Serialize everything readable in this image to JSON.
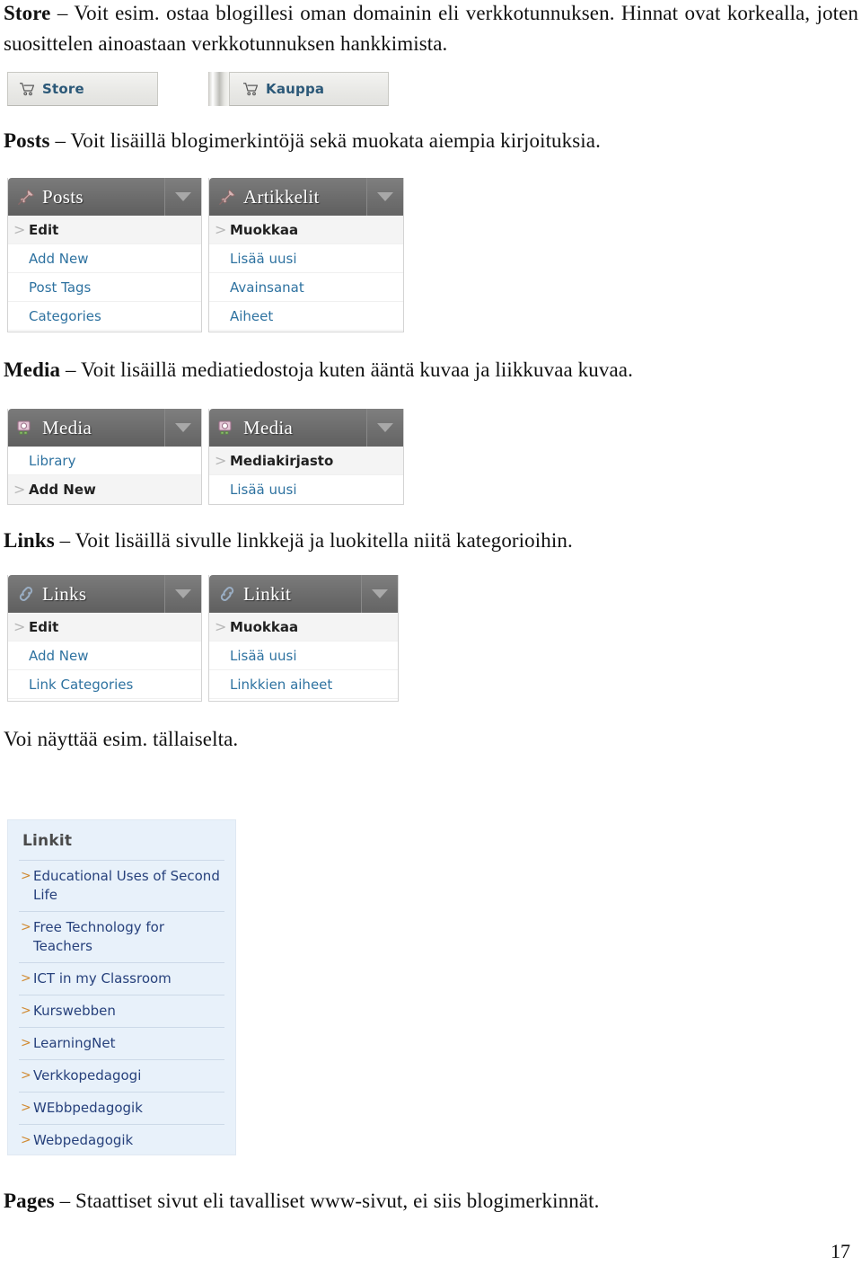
{
  "page": {
    "number": "17"
  },
  "sections": [
    {
      "id": "store",
      "lead": "Store",
      "dash": " – ",
      "text": "Voit esim. ostaa blogillesi oman domainin eli verkkotunnuksen. Hinnat ovat korkealla, joten suosittelen ainoastaan verkkotunnuksen hankkimista."
    },
    {
      "id": "posts",
      "lead": "Posts",
      "dash": " – ",
      "text": "Voit lisäillä blogimerkintöjä sekä muokata aiempia kirjoituksia."
    },
    {
      "id": "media",
      "lead": "Media",
      "dash": " – ",
      "text": "Voit lisäillä mediatiedostoja kuten ääntä kuvaa ja liikkuvaa kuvaa."
    },
    {
      "id": "links",
      "lead": "Links",
      "dash": " – ",
      "text": "Voit lisäillä sivulle linkkejä ja luokitella niitä kategorioihin."
    },
    {
      "id": "example",
      "lead": "",
      "dash": "",
      "text": "Voi näyttää esim. tällaiselta."
    },
    {
      "id": "pages",
      "lead": "Pages",
      "dash": " – ",
      "text": "Staattiset sivut eli tavalliset www-sivut, ei siis blogimerkinnät."
    }
  ],
  "store_tiles": {
    "english": {
      "label": "Store",
      "icon": "shopping-cart-icon"
    },
    "finnish": {
      "label": "Kauppa",
      "icon": "shopping-cart-icon"
    }
  },
  "menus": {
    "posts_en": {
      "title": "Posts",
      "icon": "pushpin-icon",
      "caret": "chevron-down-icon",
      "items": [
        {
          "label": "Edit",
          "current": true
        },
        {
          "label": "Add New",
          "current": false
        },
        {
          "label": "Post Tags",
          "current": false
        },
        {
          "label": "Categories",
          "current": false
        }
      ]
    },
    "posts_fi": {
      "title": "Artikkelit",
      "icon": "pushpin-icon",
      "caret": "chevron-down-icon",
      "items": [
        {
          "label": "Muokkaa",
          "current": true
        },
        {
          "label": "Lisää uusi",
          "current": false
        },
        {
          "label": "Avainsanat",
          "current": false
        },
        {
          "label": "Aiheet",
          "current": false
        }
      ]
    },
    "media_en": {
      "title": "Media",
      "icon": "camera-icon",
      "caret": "chevron-down-icon",
      "items": [
        {
          "label": "Library",
          "current": false
        },
        {
          "label": "Add New",
          "current": true
        }
      ]
    },
    "media_fi": {
      "title": "Media",
      "icon": "camera-icon",
      "caret": "chevron-down-icon",
      "items": [
        {
          "label": "Mediakirjasto",
          "current": true
        },
        {
          "label": "Lisää uusi",
          "current": false
        }
      ]
    },
    "links_en": {
      "title": "Links",
      "icon": "link-icon",
      "caret": "chevron-down-icon",
      "items": [
        {
          "label": "Edit",
          "current": true
        },
        {
          "label": "Add New",
          "current": false
        },
        {
          "label": "Link Categories",
          "current": false
        }
      ]
    },
    "links_fi": {
      "title": "Linkit",
      "icon": "link-icon",
      "caret": "chevron-down-icon",
      "items": [
        {
          "label": "Muokkaa",
          "current": true
        },
        {
          "label": "Lisää uusi",
          "current": false
        },
        {
          "label": "Linkkien aiheet",
          "current": false
        }
      ]
    }
  },
  "linkit_widget": {
    "title": "Linkit",
    "links": [
      "Educational Uses of Second Life",
      "Free Technology for Teachers",
      "ICT in my Classroom",
      "Kurswebben",
      "LearningNet",
      "Verkkopedagogi",
      "WEbbpedagogik",
      "Webpedagogik"
    ]
  },
  "colors": {
    "menu_header": "#6e6e6e",
    "menu_link": "#2e72a0",
    "widget_background": "#e8f1fa",
    "widget_link": "#27417c",
    "widget_bullet": "#d08a32",
    "tile_label": "#2b5878"
  }
}
